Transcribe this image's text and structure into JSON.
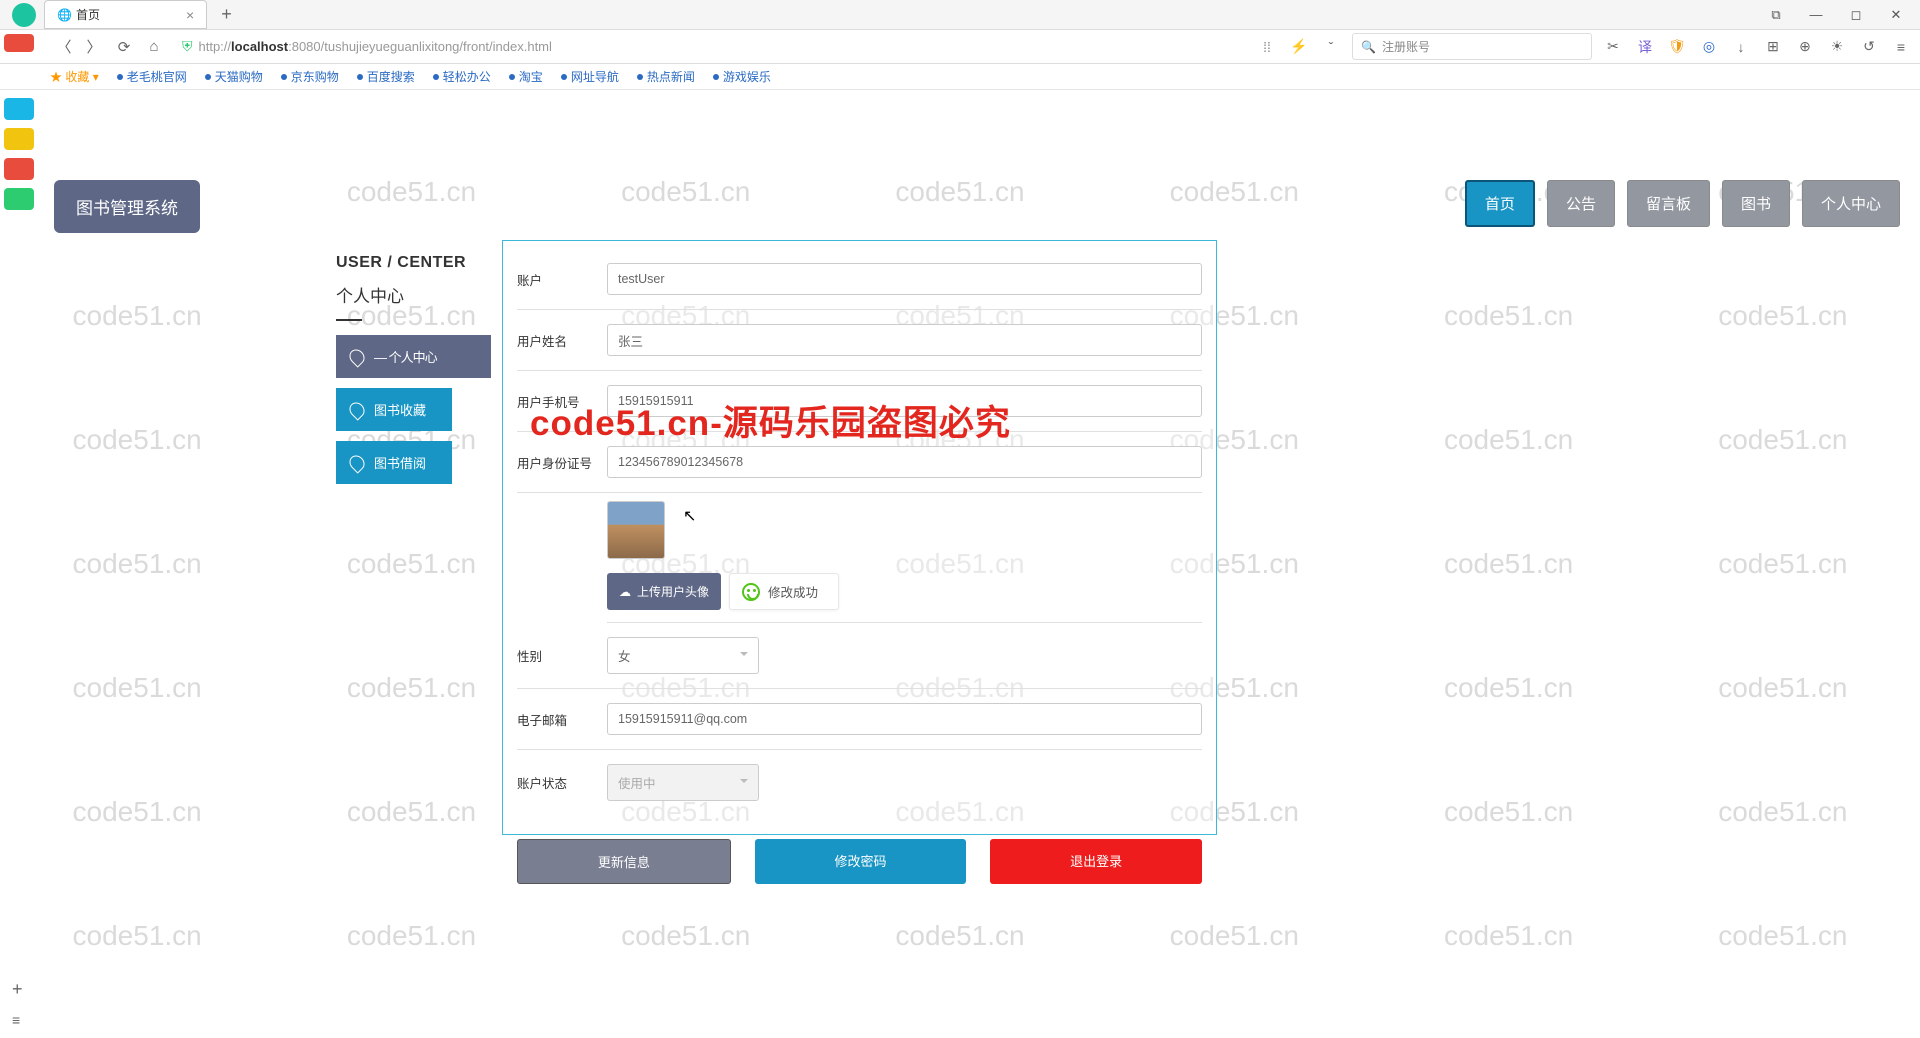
{
  "browser": {
    "tab_title": "首页",
    "url_pre": "http://",
    "url_bold": "localhost",
    "url_post": ":8080/tushujieyueguanlixitong/front/index.html",
    "search_placeholder": "注册账号",
    "fav_label": "收藏",
    "bookmarks": [
      "老毛桃官网",
      "天猫购物",
      "京东购物",
      "百度搜索",
      "轻松办公",
      "淘宝",
      "网址导航",
      "热点新闻",
      "游戏娱乐"
    ]
  },
  "app": {
    "title": "图书管理系统",
    "nav": [
      "首页",
      "公告",
      "留言板",
      "图书",
      "个人中心"
    ]
  },
  "sidebar": {
    "title": "USER / CENTER",
    "sub": "个人中心",
    "items": [
      {
        "label": "— 个人中心"
      },
      {
        "label": "图书收藏"
      },
      {
        "label": "图书借阅"
      }
    ]
  },
  "form": {
    "account_lbl": "账户",
    "account": "testUser",
    "name_lbl": "用户姓名",
    "name": "张三",
    "phone_lbl": "用户手机号",
    "phone": "15915915911",
    "idcard_lbl": "用户身份证号",
    "idcard": "123456789012345678",
    "upload_btn": "上传用户头像",
    "toast": "修改成功",
    "gender_lbl": "性别",
    "gender": "女",
    "email_lbl": "电子邮箱",
    "email": "15915915911@qq.com",
    "status_lbl": "账户状态",
    "status": "使用中"
  },
  "buttons": {
    "update": "更新信息",
    "changepwd": "修改密码",
    "logout": "退出登录"
  },
  "watermark": "code51.cn",
  "center_watermark": "code51.cn-源码乐园盗图必究"
}
